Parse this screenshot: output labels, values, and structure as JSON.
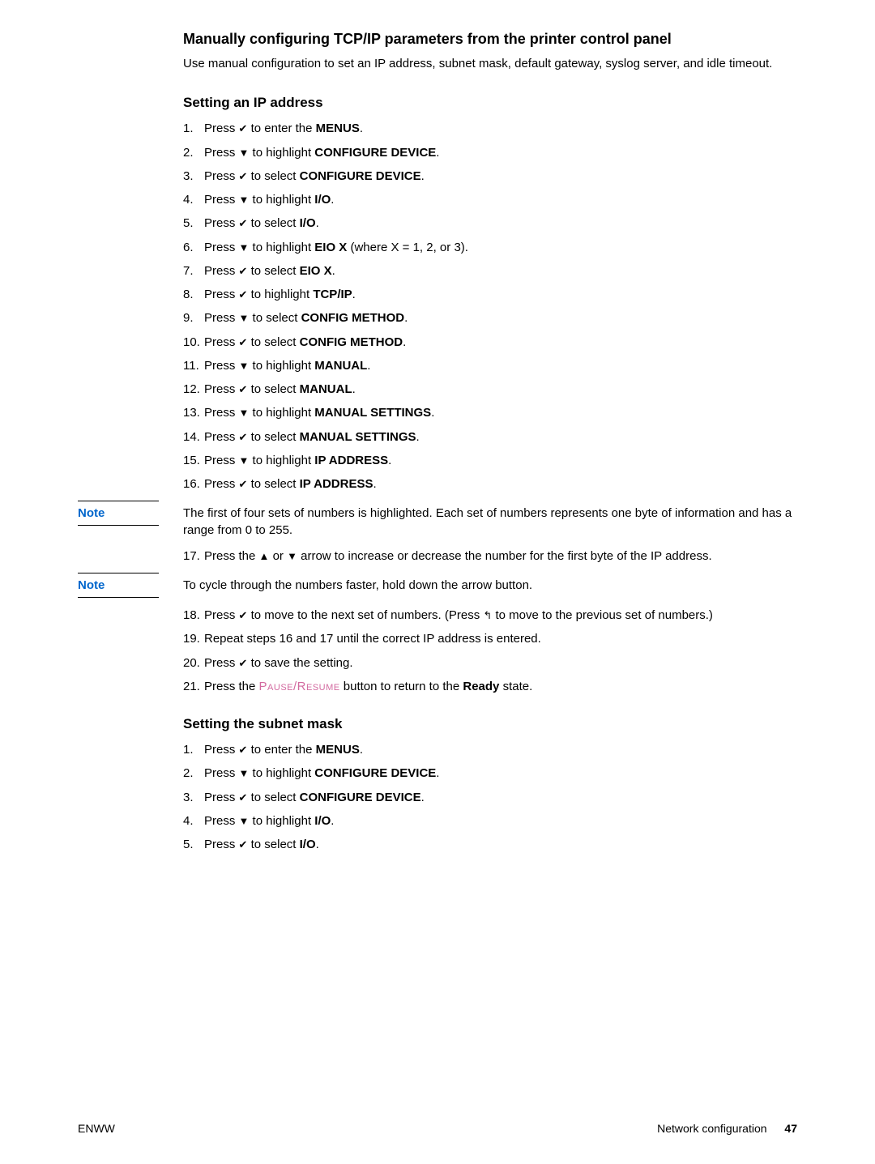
{
  "section_title": "Manually configuring TCP/IP parameters from the printer control panel",
  "intro": "Use manual configuration to set an IP address, subnet mask, default gateway, syslog server, and idle timeout.",
  "sub1_title": "Setting an IP address",
  "steps_a": [
    {
      "n": "1.",
      "pre": "Press ",
      "icon": "✔",
      "post": " to enter the ",
      "bold": "MENUS",
      "tail": "."
    },
    {
      "n": "2.",
      "pre": "Press ",
      "icon": "▼",
      "post": " to highlight ",
      "bold": "CONFIGURE DEVICE",
      "tail": "."
    },
    {
      "n": "3.",
      "pre": "Press ",
      "icon": "✔",
      "post": " to select ",
      "bold": "CONFIGURE DEVICE",
      "tail": "."
    },
    {
      "n": "4.",
      "pre": "Press ",
      "icon": "▼",
      "post": " to highlight ",
      "bold": "I/O",
      "tail": "."
    },
    {
      "n": "5.",
      "pre": "Press ",
      "icon": "✔",
      "post": " to select ",
      "bold": "I/O",
      "tail": "."
    },
    {
      "n": "6.",
      "pre": "Press ",
      "icon": "▼",
      "post": " to highlight ",
      "bold": "EIO X",
      "tail": " (where X = 1, 2, or 3)."
    },
    {
      "n": "7.",
      "pre": "Press ",
      "icon": "✔",
      "post": " to select ",
      "bold": "EIO X",
      "tail": "."
    },
    {
      "n": "8.",
      "pre": "Press ",
      "icon": "✔",
      "post": " to highlight ",
      "bold": "TCP/IP",
      "tail": "."
    },
    {
      "n": "9.",
      "pre": "Press ",
      "icon": "▼",
      "post": " to select ",
      "bold": "CONFIG METHOD",
      "tail": "."
    },
    {
      "n": "10.",
      "pre": "Press ",
      "icon": "✔",
      "post": " to select ",
      "bold": "CONFIG METHOD",
      "tail": "."
    },
    {
      "n": "11.",
      "pre": "Press ",
      "icon": "▼",
      "post": " to highlight ",
      "bold": "MANUAL",
      "tail": "."
    },
    {
      "n": "12.",
      "pre": "Press ",
      "icon": "✔",
      "post": " to select ",
      "bold": "MANUAL",
      "tail": "."
    },
    {
      "n": "13.",
      "pre": "Press ",
      "icon": "▼",
      "post": " to highlight ",
      "bold": "MANUAL SETTINGS",
      "tail": "."
    },
    {
      "n": "14.",
      "pre": "Press ",
      "icon": "✔",
      "post": " to select ",
      "bold": "MANUAL SETTINGS",
      "tail": "."
    },
    {
      "n": "15.",
      "pre": "Press ",
      "icon": "▼",
      "post": " to highlight ",
      "bold": "IP ADDRESS",
      "tail": "."
    },
    {
      "n": "16.",
      "pre": "Press ",
      "icon": "✔",
      "post": " to select ",
      "bold": "IP ADDRESS",
      "tail": "."
    }
  ],
  "note1_label": "Note",
  "note1_body": "The first of four sets of numbers is highlighted. Each set of numbers represents one byte of information and has a range from 0 to 255.",
  "step17": {
    "n": "17.",
    "pre": "Press the ",
    "icon1": "▲",
    "mid": " or ",
    "icon2": "▼",
    "post": " arrow to increase or decrease the number for the first byte of the IP address."
  },
  "note2_label": "Note",
  "note2_body": "To cycle through the numbers faster, hold down the arrow button.",
  "steps_b": [
    {
      "n": "18.",
      "pre": "Press ",
      "icon": "✔",
      "post": " to move to the next set of numbers. (Press ",
      "icon2": "↰",
      "tail": " to move to the previous set of numbers.)"
    },
    {
      "n": "19.",
      "text": "Repeat steps 16 and 17 until the correct IP address is entered."
    },
    {
      "n": "20.",
      "pre": "Press ",
      "icon": "✔",
      "post": " to save the setting."
    },
    {
      "n": "21.",
      "pre": "Press the ",
      "pause": "Pause/Resume",
      "post": " button to return to the ",
      "bold": "Ready",
      "tail": " state."
    }
  ],
  "sub2_title": "Setting the subnet mask",
  "steps_c": [
    {
      "n": "1.",
      "pre": "Press ",
      "icon": "✔",
      "post": " to enter the ",
      "bold": "MENUS",
      "tail": "."
    },
    {
      "n": "2.",
      "pre": "Press ",
      "icon": "▼",
      "post": " to highlight ",
      "bold": "CONFIGURE DEVICE",
      "tail": "."
    },
    {
      "n": "3.",
      "pre": "Press ",
      "icon": "✔",
      "post": " to select ",
      "bold": "CONFIGURE DEVICE",
      "tail": "."
    },
    {
      "n": "4.",
      "pre": "Press ",
      "icon": "▼",
      "post": " to highlight ",
      "bold": "I/O",
      "tail": "."
    },
    {
      "n": "5.",
      "pre": "Press ",
      "icon": "✔",
      "post": " to select ",
      "bold": "I/O",
      "tail": "."
    }
  ],
  "footer_left": "ENWW",
  "footer_right": "Network configuration",
  "footer_page": "47"
}
